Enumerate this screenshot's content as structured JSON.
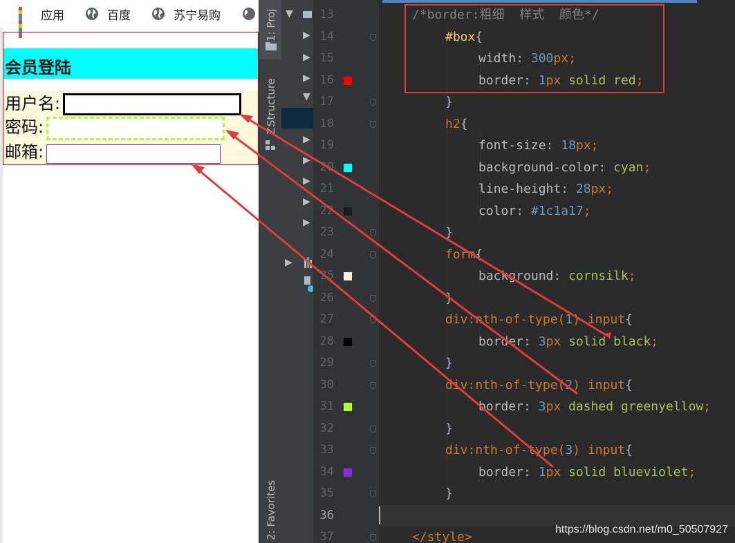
{
  "bookmarks": [
    {
      "label": "应用",
      "icon": "apps-grid-icon"
    },
    {
      "label": "百度",
      "icon": "globe-icon"
    },
    {
      "label": "苏宁易购",
      "icon": "globe-icon"
    }
  ],
  "page": {
    "heading": "会员登陆",
    "fields": [
      {
        "label": "用户名:"
      },
      {
        "label": "密码:"
      },
      {
        "label": "邮箱:"
      }
    ]
  },
  "ide": {
    "tabs": {
      "project": "1: Proj",
      "structure": "Structure",
      "structure_key": "Z:",
      "favorites": "2: Favorites"
    },
    "line_numbers": [
      "13",
      "14",
      "15",
      "16",
      "17",
      "18",
      "19",
      "20",
      "21",
      "22",
      "23",
      "24",
      "25",
      "26",
      "27",
      "28",
      "29",
      "30",
      "31",
      "32",
      "33",
      "34",
      "35",
      "36",
      "37"
    ],
    "swatches": [
      {
        "line": "16",
        "color": "#ff0000"
      },
      {
        "line": "20",
        "color": "#00ffff"
      },
      {
        "line": "22",
        "color": "#1c1a17"
      },
      {
        "line": "25",
        "color": "#fff8dc"
      },
      {
        "line": "28",
        "color": "#000000"
      },
      {
        "line": "31",
        "color": "#adff2f"
      },
      {
        "line": "34",
        "color": "#8a2be2"
      }
    ]
  },
  "code": {
    "l13": {
      "comment": "/*border:粗细  样式  颜色*/"
    },
    "l14": {
      "sel": "#box",
      "brace": "{"
    },
    "l15": {
      "prop": "width",
      "colon": ": ",
      "num": "300",
      "unit": "px",
      "semi": ";"
    },
    "l16": {
      "prop": "border",
      "colon": ": ",
      "num": "1",
      "unit": "px",
      "val": " solid red",
      "semi": ";"
    },
    "l17": {
      "brace": "}"
    },
    "l18": {
      "sel": "h2",
      "brace": "{"
    },
    "l19": {
      "prop": "font-size",
      "colon": ": ",
      "num": "18",
      "unit": "px",
      "semi": ";"
    },
    "l20": {
      "prop": "background-color",
      "colon": ": ",
      "val": "cyan",
      "semi": ";"
    },
    "l21": {
      "prop": "line-height",
      "colon": ": ",
      "num": "28",
      "unit": "px",
      "semi": ";"
    },
    "l22": {
      "prop": "color",
      "colon": ": ",
      "num": "#1c1a17",
      "semi": ";"
    },
    "l23": {
      "brace": "}"
    },
    "l24": {
      "sel": "form",
      "brace": "{"
    },
    "l25": {
      "prop": "background",
      "colon": ": ",
      "val": "cornsilk",
      "semi": ";"
    },
    "l26": {
      "brace": "}"
    },
    "l27": {
      "sel": "div",
      "pseudo": ":nth-of-type(",
      "num": "1",
      "close": ") ",
      "sel2": "input",
      "brace": "{"
    },
    "l28": {
      "prop": "border",
      "colon": ": ",
      "num": "3",
      "unit": "px",
      "val": " solid black",
      "semi": ";"
    },
    "l29": {
      "brace": "}"
    },
    "l30": {
      "sel": "div",
      "pseudo": ":nth-of-type(",
      "num": "2",
      "close": ") ",
      "sel2": "input",
      "brace": "{"
    },
    "l31": {
      "prop": "border",
      "colon": ": ",
      "num": "3",
      "unit": "px",
      "val": " dashed greenyellow",
      "semi": ";"
    },
    "l32": {
      "brace": "}"
    },
    "l33": {
      "sel": "div",
      "pseudo": ":nth-of-type(",
      "num": "3",
      "close": ") ",
      "sel2": "input",
      "brace": "{"
    },
    "l34": {
      "prop": "border",
      "colon": ": ",
      "num": "1",
      "unit": "px",
      "val": " solid blueviolet",
      "semi": ";"
    },
    "l35": {
      "brace": "}"
    },
    "l37": {
      "tag": "</style>"
    }
  },
  "watermark": "https://blog.csdn.net/m0_50507927",
  "colors": {
    "annotation": "#e03c3c",
    "cyan": "#00ffff",
    "cornsilk": "#fff8dc",
    "greenyellow": "#adff2f",
    "blueviolet": "#8a2be2"
  }
}
